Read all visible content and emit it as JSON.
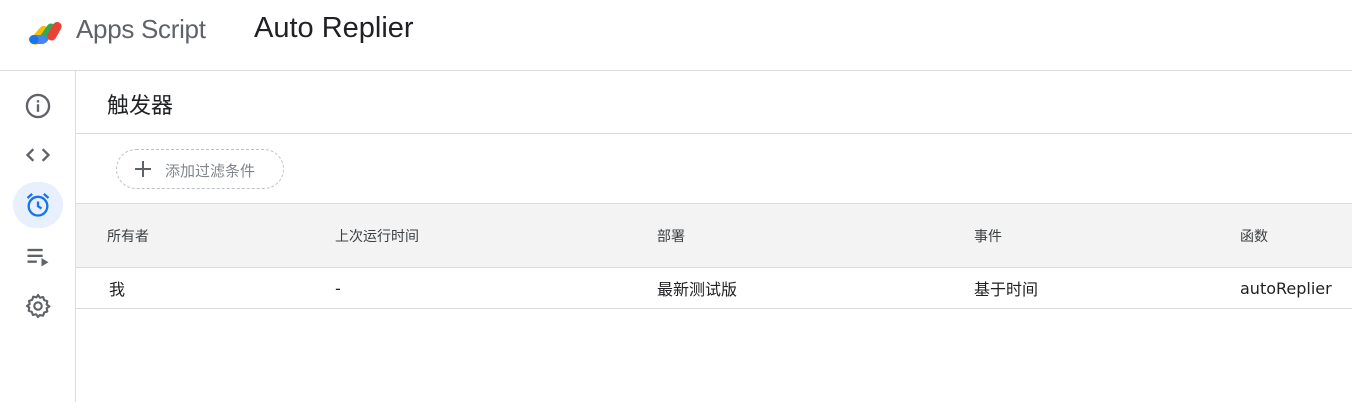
{
  "header": {
    "app_name": "Apps Script",
    "project_title": "Auto Replier"
  },
  "sidebar": {
    "items": [
      {
        "name": "overview",
        "icon": "info-icon"
      },
      {
        "name": "editor",
        "icon": "code-icon"
      },
      {
        "name": "triggers",
        "icon": "alarm-clock-icon",
        "active": true
      },
      {
        "name": "executions",
        "icon": "executions-list-icon"
      },
      {
        "name": "settings",
        "icon": "gear-icon"
      }
    ]
  },
  "main": {
    "page_title": "触发器",
    "filter_label": "添加过滤条件",
    "columns": [
      "所有者",
      "上次运行时间",
      "部署",
      "事件",
      "函数"
    ],
    "rows": [
      [
        "我",
        "-",
        "最新测试版",
        "基于时间",
        "autoReplier"
      ]
    ]
  },
  "colors": {
    "accent": "#1a73e8",
    "active_bg": "#e8f0fe",
    "icon": "#5f6368",
    "divider": "#dadce0",
    "header_bg": "#f3f3f3"
  }
}
